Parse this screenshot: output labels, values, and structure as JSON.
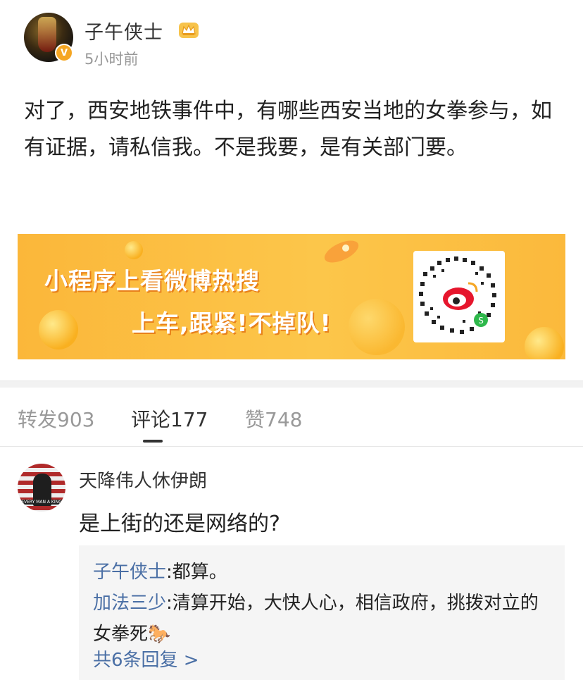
{
  "post": {
    "author": "子午侠士",
    "time": "5小时前",
    "verified_badge": "V",
    "text": "对了，西安地铁事件中，有哪些西安当地的女拳参与，如有证据，请私信我。不是我要，是有关部门要。"
  },
  "banner": {
    "line1": "小程序上看微博热搜",
    "line2": "上车,跟紧!不掉队!"
  },
  "tabs": [
    {
      "label": "转发903"
    },
    {
      "label": "评论177"
    },
    {
      "label": "赞748"
    }
  ],
  "comment": {
    "user": "天降伟人休伊朗",
    "text": "是上街的还是网络的?",
    "avatar_caption": "EVERY MAN A KING",
    "replies": [
      {
        "user": "子午侠士",
        "sep": ":",
        "text": "都算。"
      },
      {
        "user": "加法三少",
        "sep": ":",
        "text": "清算开始，大快人心，相信政府，挑拨对立的女拳死🐎"
      }
    ],
    "more_replies": "共6条回复 >"
  },
  "colors": {
    "link_blue": "#4a6fa5",
    "banner_yellow": "#fcc64a",
    "badge_orange": "#f5a623"
  }
}
